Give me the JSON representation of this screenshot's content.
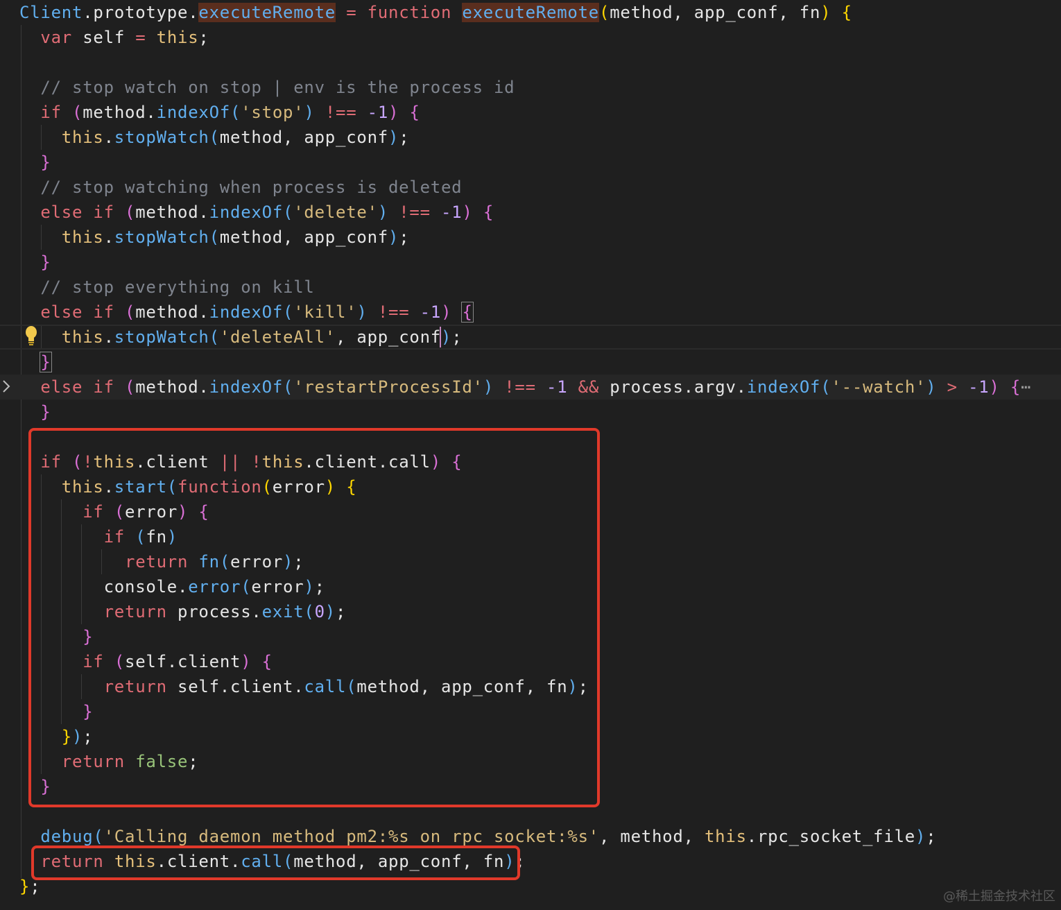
{
  "editor": {
    "lines": [
      [
        [
          "Client",
          "t-cls"
        ],
        [
          ".",
          "t-id"
        ],
        [
          "prototype",
          "t-id"
        ],
        [
          ".",
          "t-id"
        ],
        [
          "executeRemote",
          "t-fn t-hl"
        ],
        [
          " ",
          "t-id"
        ],
        [
          "=",
          "t-op"
        ],
        [
          " ",
          "t-id"
        ],
        [
          "function",
          "t-kw"
        ],
        [
          " ",
          "t-id"
        ],
        [
          "executeRemote",
          "t-fn t-hl"
        ],
        [
          "(",
          "t-p1"
        ],
        [
          "method, app_conf, fn",
          "t-id"
        ],
        [
          ")",
          "t-p1"
        ],
        [
          " ",
          "t-id"
        ],
        [
          "{",
          "t-p1"
        ]
      ],
      [
        [
          "  ",
          "t-id"
        ],
        [
          "var",
          "t-kw"
        ],
        [
          " self ",
          "t-id"
        ],
        [
          "=",
          "t-op"
        ],
        [
          " ",
          "t-id"
        ],
        [
          "this",
          "t-this"
        ],
        [
          ";",
          "t-id"
        ]
      ],
      [],
      [
        [
          "  ",
          "t-id"
        ],
        [
          "// stop watch on stop | env is the process id",
          "t-cmt"
        ]
      ],
      [
        [
          "  ",
          "t-id"
        ],
        [
          "if",
          "t-kw"
        ],
        [
          " ",
          "t-id"
        ],
        [
          "(",
          "t-p2"
        ],
        [
          "method",
          "t-id"
        ],
        [
          ".",
          "t-id"
        ],
        [
          "indexOf",
          "t-fn"
        ],
        [
          "(",
          "t-p3"
        ],
        [
          "'stop'",
          "t-str"
        ],
        [
          ")",
          "t-p3"
        ],
        [
          " ",
          "t-id"
        ],
        [
          "!==",
          "t-op"
        ],
        [
          " ",
          "t-id"
        ],
        [
          "-1",
          "t-num"
        ],
        [
          ")",
          "t-p2"
        ],
        [
          " ",
          "t-id"
        ],
        [
          "{",
          "t-p2"
        ]
      ],
      [
        [
          "    ",
          "t-id"
        ],
        [
          "this",
          "t-this"
        ],
        [
          ".",
          "t-id"
        ],
        [
          "stopWatch",
          "t-fn"
        ],
        [
          "(",
          "t-p3"
        ],
        [
          "method, app_conf",
          "t-id"
        ],
        [
          ")",
          "t-p3"
        ],
        [
          ";",
          "t-id"
        ]
      ],
      [
        [
          "  ",
          "t-id"
        ],
        [
          "}",
          "t-p2"
        ]
      ],
      [
        [
          "  ",
          "t-id"
        ],
        [
          "// stop watching when process is deleted",
          "t-cmt"
        ]
      ],
      [
        [
          "  ",
          "t-id"
        ],
        [
          "else",
          "t-kw"
        ],
        [
          " ",
          "t-id"
        ],
        [
          "if",
          "t-kw"
        ],
        [
          " ",
          "t-id"
        ],
        [
          "(",
          "t-p2"
        ],
        [
          "method",
          "t-id"
        ],
        [
          ".",
          "t-id"
        ],
        [
          "indexOf",
          "t-fn"
        ],
        [
          "(",
          "t-p3"
        ],
        [
          "'delete'",
          "t-str"
        ],
        [
          ")",
          "t-p3"
        ],
        [
          " ",
          "t-id"
        ],
        [
          "!==",
          "t-op"
        ],
        [
          " ",
          "t-id"
        ],
        [
          "-1",
          "t-num"
        ],
        [
          ")",
          "t-p2"
        ],
        [
          " ",
          "t-id"
        ],
        [
          "{",
          "t-p2"
        ]
      ],
      [
        [
          "    ",
          "t-id"
        ],
        [
          "this",
          "t-this"
        ],
        [
          ".",
          "t-id"
        ],
        [
          "stopWatch",
          "t-fn"
        ],
        [
          "(",
          "t-p3"
        ],
        [
          "method, app_conf",
          "t-id"
        ],
        [
          ")",
          "t-p3"
        ],
        [
          ";",
          "t-id"
        ]
      ],
      [
        [
          "  ",
          "t-id"
        ],
        [
          "}",
          "t-p2"
        ]
      ],
      [
        [
          "  ",
          "t-id"
        ],
        [
          "// stop everything on kill",
          "t-cmt"
        ]
      ],
      [
        [
          "  ",
          "t-id"
        ],
        [
          "else",
          "t-kw"
        ],
        [
          " ",
          "t-id"
        ],
        [
          "if",
          "t-kw"
        ],
        [
          " ",
          "t-id"
        ],
        [
          "(",
          "t-p2"
        ],
        [
          "method",
          "t-id"
        ],
        [
          ".",
          "t-id"
        ],
        [
          "indexOf",
          "t-fn"
        ],
        [
          "(",
          "t-p3"
        ],
        [
          "'kill'",
          "t-str"
        ],
        [
          ")",
          "t-p3"
        ],
        [
          " ",
          "t-id"
        ],
        [
          "!==",
          "t-op"
        ],
        [
          " ",
          "t-id"
        ],
        [
          "-1",
          "t-num"
        ],
        [
          ")",
          "t-p2"
        ],
        [
          " ",
          "t-id"
        ],
        [
          "{",
          "t-p2 bm"
        ]
      ],
      [
        [
          "    ",
          "t-id"
        ],
        [
          "this",
          "t-this"
        ],
        [
          ".",
          "t-id"
        ],
        [
          "stopWatch",
          "t-fn"
        ],
        [
          "(",
          "t-p3"
        ],
        [
          "'deleteAll'",
          "t-str"
        ],
        [
          ", app_conf",
          "t-id"
        ],
        [
          ")",
          "t-p3"
        ],
        [
          ";",
          "t-id"
        ]
      ],
      [
        [
          "  ",
          "t-id"
        ],
        [
          "}",
          "t-p2 bm"
        ]
      ],
      [
        [
          "  ",
          "t-id"
        ],
        [
          "else",
          "t-kw"
        ],
        [
          " ",
          "t-id"
        ],
        [
          "if",
          "t-kw"
        ],
        [
          " ",
          "t-id"
        ],
        [
          "(",
          "t-p2"
        ],
        [
          "method",
          "t-id"
        ],
        [
          ".",
          "t-id"
        ],
        [
          "indexOf",
          "t-fn"
        ],
        [
          "(",
          "t-p3"
        ],
        [
          "'restartProcessId'",
          "t-str"
        ],
        [
          ")",
          "t-p3"
        ],
        [
          " ",
          "t-id"
        ],
        [
          "!==",
          "t-op"
        ],
        [
          " ",
          "t-id"
        ],
        [
          "-1",
          "t-num"
        ],
        [
          " ",
          "t-id"
        ],
        [
          "&&",
          "t-op"
        ],
        [
          " process",
          "t-id"
        ],
        [
          ".",
          "t-id"
        ],
        [
          "argv",
          "t-id"
        ],
        [
          ".",
          "t-id"
        ],
        [
          "indexOf",
          "t-fn"
        ],
        [
          "(",
          "t-p3"
        ],
        [
          "'--watch'",
          "t-str"
        ],
        [
          ")",
          "t-p3"
        ],
        [
          " ",
          "t-id"
        ],
        [
          ">",
          "t-op"
        ],
        [
          " ",
          "t-id"
        ],
        [
          "-1",
          "t-num"
        ],
        [
          ")",
          "t-p2"
        ],
        [
          " ",
          "t-id"
        ],
        [
          "{",
          "t-p2"
        ],
        [
          "⋯",
          "ellipsis"
        ]
      ],
      [
        [
          "  ",
          "t-id"
        ],
        [
          "}",
          "t-p2"
        ]
      ],
      [],
      [
        [
          "  ",
          "t-id"
        ],
        [
          "if",
          "t-kw"
        ],
        [
          " ",
          "t-id"
        ],
        [
          "(",
          "t-p2"
        ],
        [
          "!",
          "t-op"
        ],
        [
          "this",
          "t-this"
        ],
        [
          ".client ",
          "t-id"
        ],
        [
          "||",
          "t-op"
        ],
        [
          " ",
          "t-id"
        ],
        [
          "!",
          "t-op"
        ],
        [
          "this",
          "t-this"
        ],
        [
          ".client.call",
          "t-id"
        ],
        [
          ")",
          "t-p2"
        ],
        [
          " ",
          "t-id"
        ],
        [
          "{",
          "t-p2"
        ]
      ],
      [
        [
          "    ",
          "t-id"
        ],
        [
          "this",
          "t-this"
        ],
        [
          ".",
          "t-id"
        ],
        [
          "start",
          "t-fn"
        ],
        [
          "(",
          "t-p3"
        ],
        [
          "function",
          "t-kw"
        ],
        [
          "(",
          "t-p1"
        ],
        [
          "error",
          "t-id"
        ],
        [
          ")",
          "t-p1"
        ],
        [
          " ",
          "t-id"
        ],
        [
          "{",
          "t-p1"
        ]
      ],
      [
        [
          "      ",
          "t-id"
        ],
        [
          "if",
          "t-kw"
        ],
        [
          " ",
          "t-id"
        ],
        [
          "(",
          "t-p2"
        ],
        [
          "error",
          "t-id"
        ],
        [
          ")",
          "t-p2"
        ],
        [
          " ",
          "t-id"
        ],
        [
          "{",
          "t-p2"
        ]
      ],
      [
        [
          "        ",
          "t-id"
        ],
        [
          "if",
          "t-kw"
        ],
        [
          " ",
          "t-id"
        ],
        [
          "(",
          "t-p3"
        ],
        [
          "fn",
          "t-id"
        ],
        [
          ")",
          "t-p3"
        ]
      ],
      [
        [
          "          ",
          "t-id"
        ],
        [
          "return",
          "t-kw"
        ],
        [
          " ",
          "t-id"
        ],
        [
          "fn",
          "t-fn"
        ],
        [
          "(",
          "t-p3"
        ],
        [
          "error",
          "t-id"
        ],
        [
          ")",
          "t-p3"
        ],
        [
          ";",
          "t-id"
        ]
      ],
      [
        [
          "        ",
          "t-id"
        ],
        [
          "console",
          "t-id"
        ],
        [
          ".",
          "t-id"
        ],
        [
          "error",
          "t-fn"
        ],
        [
          "(",
          "t-p3"
        ],
        [
          "error",
          "t-id"
        ],
        [
          ")",
          "t-p3"
        ],
        [
          ";",
          "t-id"
        ]
      ],
      [
        [
          "        ",
          "t-id"
        ],
        [
          "return",
          "t-kw"
        ],
        [
          " process",
          "t-id"
        ],
        [
          ".",
          "t-id"
        ],
        [
          "exit",
          "t-fn"
        ],
        [
          "(",
          "t-p3"
        ],
        [
          "0",
          "t-num"
        ],
        [
          ")",
          "t-p3"
        ],
        [
          ";",
          "t-id"
        ]
      ],
      [
        [
          "      ",
          "t-id"
        ],
        [
          "}",
          "t-p2"
        ]
      ],
      [
        [
          "      ",
          "t-id"
        ],
        [
          "if",
          "t-kw"
        ],
        [
          " ",
          "t-id"
        ],
        [
          "(",
          "t-p2"
        ],
        [
          "self",
          "t-id"
        ],
        [
          ".",
          "t-id"
        ],
        [
          "client",
          "t-id"
        ],
        [
          ")",
          "t-p2"
        ],
        [
          " ",
          "t-id"
        ],
        [
          "{",
          "t-p2"
        ]
      ],
      [
        [
          "        ",
          "t-id"
        ],
        [
          "return",
          "t-kw"
        ],
        [
          " self",
          "t-id"
        ],
        [
          ".",
          "t-id"
        ],
        [
          "client",
          "t-id"
        ],
        [
          ".",
          "t-id"
        ],
        [
          "call",
          "t-fn"
        ],
        [
          "(",
          "t-p3"
        ],
        [
          "method, app_conf, fn",
          "t-id"
        ],
        [
          ")",
          "t-p3"
        ],
        [
          ";",
          "t-id"
        ]
      ],
      [
        [
          "      ",
          "t-id"
        ],
        [
          "}",
          "t-p2"
        ]
      ],
      [
        [
          "    ",
          "t-id"
        ],
        [
          "}",
          "t-p1"
        ],
        [
          ")",
          "t-p3"
        ],
        [
          ";",
          "t-id"
        ]
      ],
      [
        [
          "    ",
          "t-id"
        ],
        [
          "return",
          "t-kw"
        ],
        [
          " ",
          "t-id"
        ],
        [
          "false",
          "t-bool"
        ],
        [
          ";",
          "t-id"
        ]
      ],
      [
        [
          "  ",
          "t-id"
        ],
        [
          "}",
          "t-p2"
        ]
      ],
      [],
      [
        [
          "  ",
          "t-id"
        ],
        [
          "debug",
          "t-fn"
        ],
        [
          "(",
          "t-p3"
        ],
        [
          "'Calling daemon method pm2:%s on rpc socket:%s'",
          "t-str"
        ],
        [
          ", method, ",
          "t-id"
        ],
        [
          "this",
          "t-this"
        ],
        [
          ".",
          "t-id"
        ],
        [
          "rpc_socket_file",
          "t-id"
        ],
        [
          ")",
          "t-p3"
        ],
        [
          ";",
          "t-id"
        ]
      ],
      [
        [
          "  ",
          "t-id"
        ],
        [
          "return",
          "t-kw"
        ],
        [
          " ",
          "t-id"
        ],
        [
          "this",
          "t-this"
        ],
        [
          ".",
          "t-id"
        ],
        [
          "client",
          "t-id"
        ],
        [
          ".",
          "t-id"
        ],
        [
          "call",
          "t-fn"
        ],
        [
          "(",
          "t-p3"
        ],
        [
          "method, app_conf, fn",
          "t-id"
        ],
        [
          ")",
          "t-p3"
        ],
        [
          ";",
          "t-id"
        ]
      ],
      [
        [
          "}",
          "t-p1"
        ],
        [
          ";",
          "t-id"
        ]
      ]
    ]
  },
  "watermark": "@稀土掘金技术社区"
}
